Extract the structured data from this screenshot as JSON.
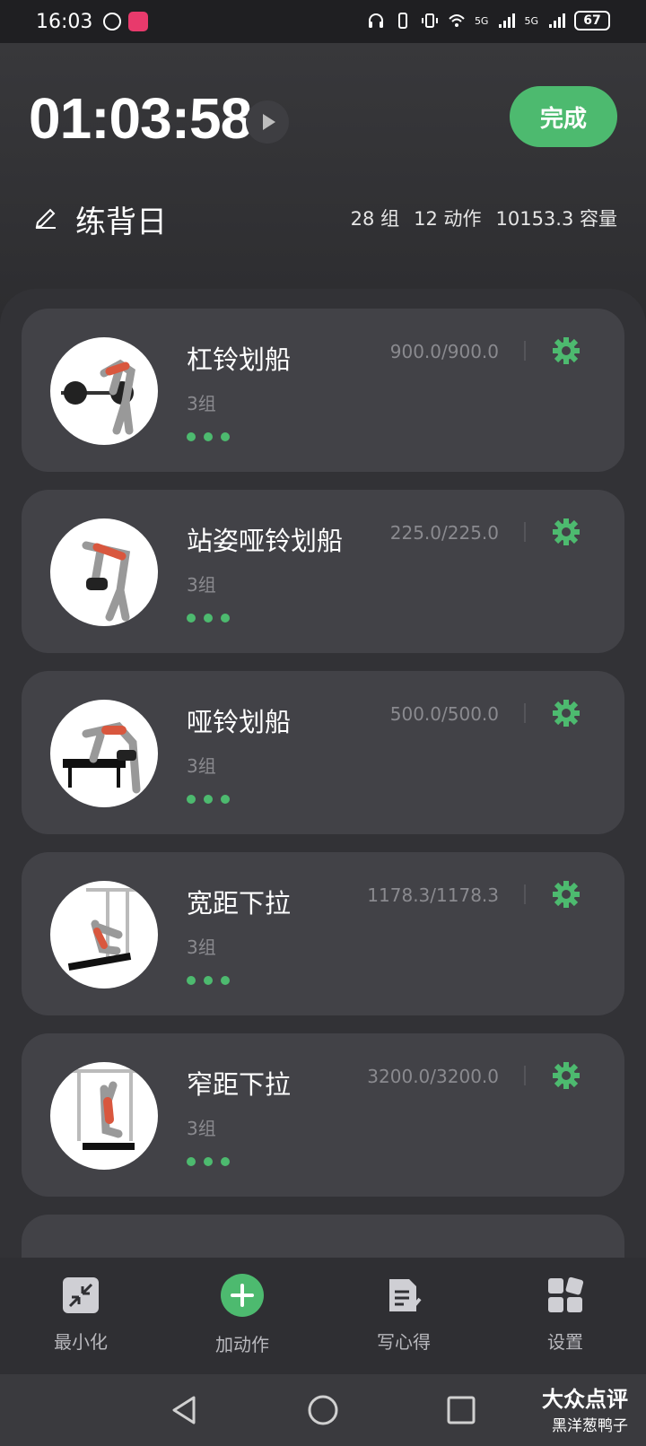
{
  "status_bar": {
    "time": "16:03",
    "battery": "67",
    "network_5g_a": "5G",
    "network_5g_b": "5G"
  },
  "header": {
    "timer": "01:03:58",
    "finish_label": "完成",
    "title": "练背日",
    "stats": {
      "sets": "28 组",
      "exercises": "12 动作",
      "volume": "10153.3 容量"
    }
  },
  "exercises": [
    {
      "name": "杠铃划船",
      "sets": "3组",
      "volume": "900.0/900.0"
    },
    {
      "name": "站姿哑铃划船",
      "sets": "3组",
      "volume": "225.0/225.0"
    },
    {
      "name": "哑铃划船",
      "sets": "3组",
      "volume": "500.0/500.0"
    },
    {
      "name": "宽距下拉",
      "sets": "3组",
      "volume": "1178.3/1178.3"
    },
    {
      "name": "窄距下拉",
      "sets": "3组",
      "volume": "3200.0/3200.0"
    }
  ],
  "toolbar": {
    "minimize_label": "最小化",
    "add_label": "加动作",
    "notes_label": "写心得",
    "settings_label": "设置"
  },
  "watermark": {
    "brand": "大众点评",
    "user": "黑洋葱鸭子"
  },
  "colors": {
    "accent": "#4dba6f",
    "background": "#2c2c2f",
    "card": "#424247"
  }
}
